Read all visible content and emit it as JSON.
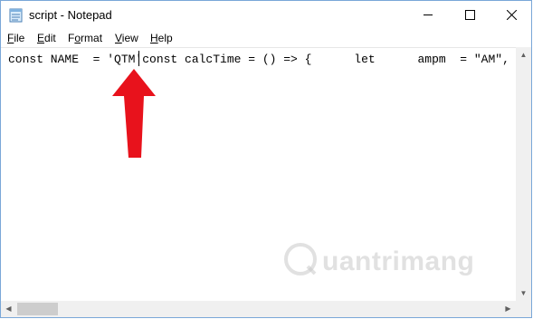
{
  "window": {
    "title": "script - Notepad"
  },
  "menu": [
    {
      "prefix": "",
      "ul": "F",
      "rest": "ile"
    },
    {
      "prefix": "",
      "ul": "E",
      "rest": "dit"
    },
    {
      "prefix": "F",
      "ul": "o",
      "rest": "rmat"
    },
    {
      "prefix": "",
      "ul": "V",
      "rest": "iew"
    },
    {
      "prefix": "",
      "ul": "H",
      "rest": "elp"
    }
  ],
  "editor": {
    "text": "const NAME  = 'QTM'const calcTime = () => {      let      ampm  = \"AM\","
  },
  "watermark": {
    "text": "uantrimang"
  },
  "colors": {
    "arrow": "#e8121c",
    "accent_border": "#7aa7d8"
  }
}
